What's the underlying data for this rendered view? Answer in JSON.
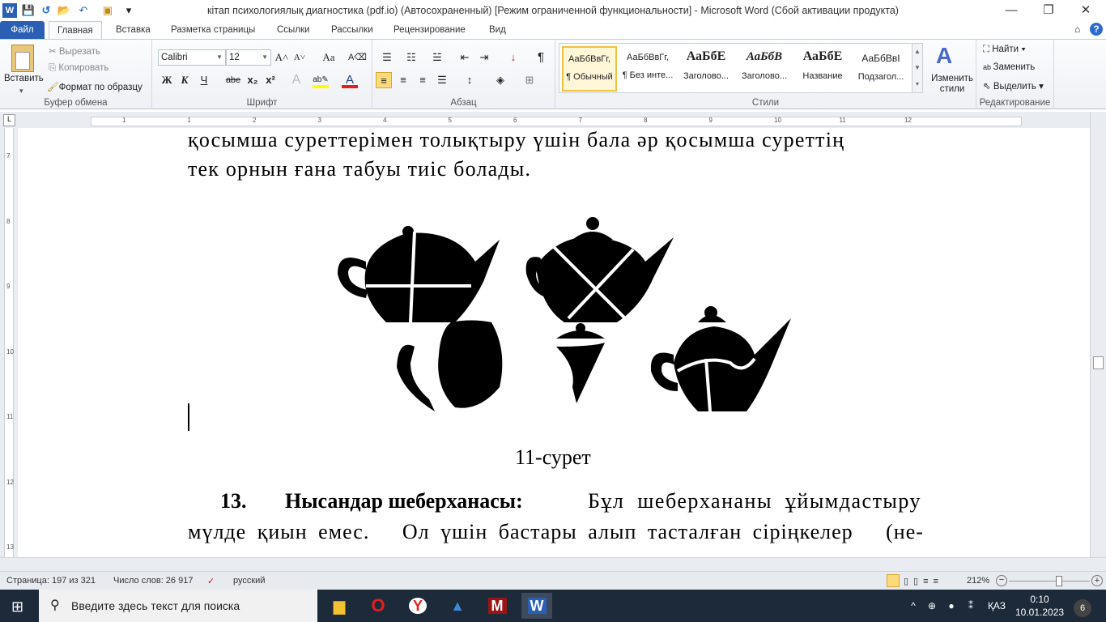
{
  "window": {
    "title": "кітап психологиялық диагностика (pdf.io) (Автосохраненный) [Режим ограниченной функциональности]  -  Microsoft Word (Сбой активации продукта)",
    "minimize": "—",
    "restore": "❐",
    "close": "✕"
  },
  "qat": {
    "word_icon": "W",
    "save": "💾",
    "redo": "↺",
    "open": "📂",
    "undo": "↶",
    "more": "▾"
  },
  "tabs": [
    {
      "label": "Файл"
    },
    {
      "label": "Главная"
    },
    {
      "label": "Вставка"
    },
    {
      "label": "Разметка страницы"
    },
    {
      "label": "Ссылки"
    },
    {
      "label": "Рассылки"
    },
    {
      "label": "Рецензирование"
    },
    {
      "label": "Вид"
    }
  ],
  "ribbon": {
    "clipboard": {
      "label": "Буфер обмена",
      "paste": "Вставить",
      "cut": "Вырезать",
      "copy": "Копировать",
      "format_painter": "Формат по образцу"
    },
    "font": {
      "label": "Шрифт",
      "name": "Calibri",
      "size": "12",
      "bold": "Ж",
      "italic": "К",
      "underline": "Ч",
      "strike": "abe",
      "sub": "x₂",
      "sup": "x²",
      "grow": "A˄",
      "shrink": "A˅",
      "case": "Aa"
    },
    "paragraph": {
      "label": "Абзац",
      "pilcrow": "¶"
    },
    "styles": {
      "label": "Стили",
      "items": [
        {
          "sample": "АаБбВвГг,",
          "name": "¶ Обычный"
        },
        {
          "sample": "АаБбВвГг,",
          "name": "¶ Без инте..."
        },
        {
          "sample": "АаБбЕ",
          "name": "Заголово..."
        },
        {
          "sample": "АаБбВ",
          "name": "Заголово..."
        },
        {
          "sample": "АаБбЕ",
          "name": "Название"
        },
        {
          "sample": "АаБбВвI",
          "name": "Подзагол..."
        }
      ],
      "change_styles": "Изменить стили"
    },
    "editing": {
      "label": "Редактирование",
      "find": "Найти",
      "replace": "Заменить",
      "select": "Выделить"
    }
  },
  "ruler": {
    "h_ticks": [
      "1",
      "1",
      "2",
      "3",
      "4",
      "5",
      "6",
      "7",
      "8",
      "9",
      "10",
      "11",
      "12"
    ],
    "v_ticks": [
      "7",
      "8",
      "9",
      "10",
      "11",
      "12",
      "13"
    ]
  },
  "document": {
    "line1": "қосымша суреттерімен толықтыру үшін бала әр қосымша суреттің",
    "line2": "тек орнын ғана табуы тиіс болады.",
    "caption": "11-сурет",
    "para_number": "13.",
    "para_heading": "Нысандар шеберханасы:",
    "para_line1": "Бұл шеберхананы ұйымдастыру",
    "para_line2": "мүлде қиын емес.   Ол үшін бастары алып тасталған сіріңкелер   (не-"
  },
  "status": {
    "page": "Страница: 197 из 321",
    "words": "Число слов: 26 917",
    "language": "русский",
    "zoom": "212%",
    "zoom_value": 212
  },
  "taskbar": {
    "search_placeholder": "Введите здесь текст для поиска",
    "language": "ҚАЗ",
    "time": "0:10",
    "date": "10.01.2023",
    "notifications": "6"
  }
}
